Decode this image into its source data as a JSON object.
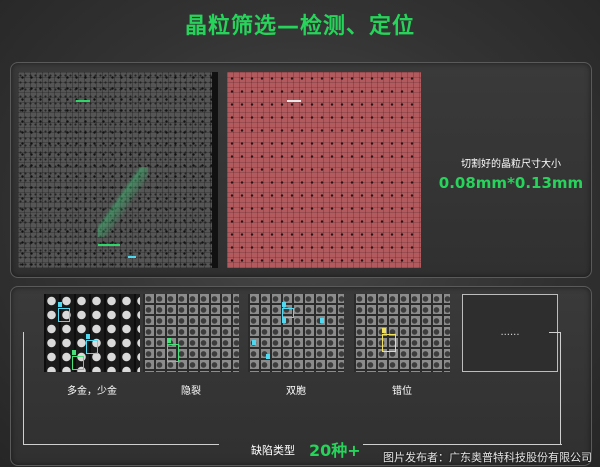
{
  "header": {
    "title": "晶粒筛选—检测、定位"
  },
  "top_panel": {
    "size_label": "切割好的晶粒尺寸大小",
    "size_value": "0.08mm*0.13mm"
  },
  "defects": {
    "items": [
      {
        "id": "a",
        "caption": "多金，少金"
      },
      {
        "id": "b",
        "caption": "隐裂"
      },
      {
        "id": "c",
        "caption": "双胞"
      },
      {
        "id": "d",
        "caption": "错位"
      },
      {
        "id": "e",
        "caption": "......"
      }
    ],
    "types_label": "缺陷类型",
    "types_count": "20种+"
  },
  "watermark": "图片发布者：广东奥普特科技股份有限公司",
  "colors": {
    "accent": "#27d35a",
    "label_cyan": "#4fd8f0",
    "label_yellow": "#f0e060"
  }
}
